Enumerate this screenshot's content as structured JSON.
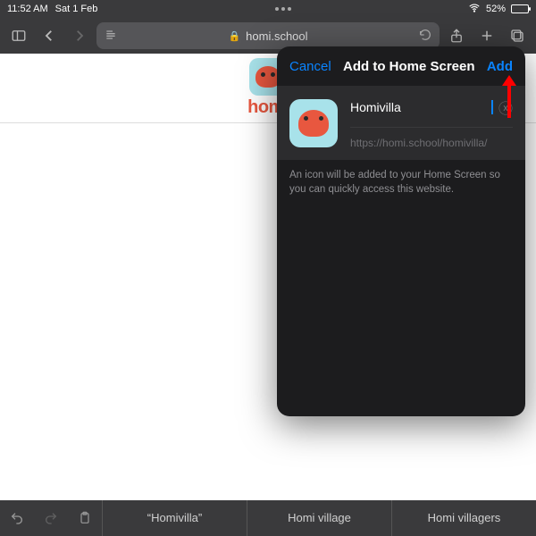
{
  "status": {
    "time": "11:52 AM",
    "date": "Sat 1 Feb",
    "battery_pct": "52%"
  },
  "toolbar": {
    "url_host": "homi.school"
  },
  "page": {
    "logo_text": "homi"
  },
  "popover": {
    "cancel": "Cancel",
    "title": "Add to Home Screen",
    "add": "Add",
    "name_value": "Homivilla",
    "url": "https://homi.school/homivilla/",
    "description": "An icon will be added to your Home Screen so you can quickly access this website."
  },
  "suggestions": {
    "s1": "“Homivilla”",
    "s2": "Homi village",
    "s3": "Homi villagers"
  }
}
